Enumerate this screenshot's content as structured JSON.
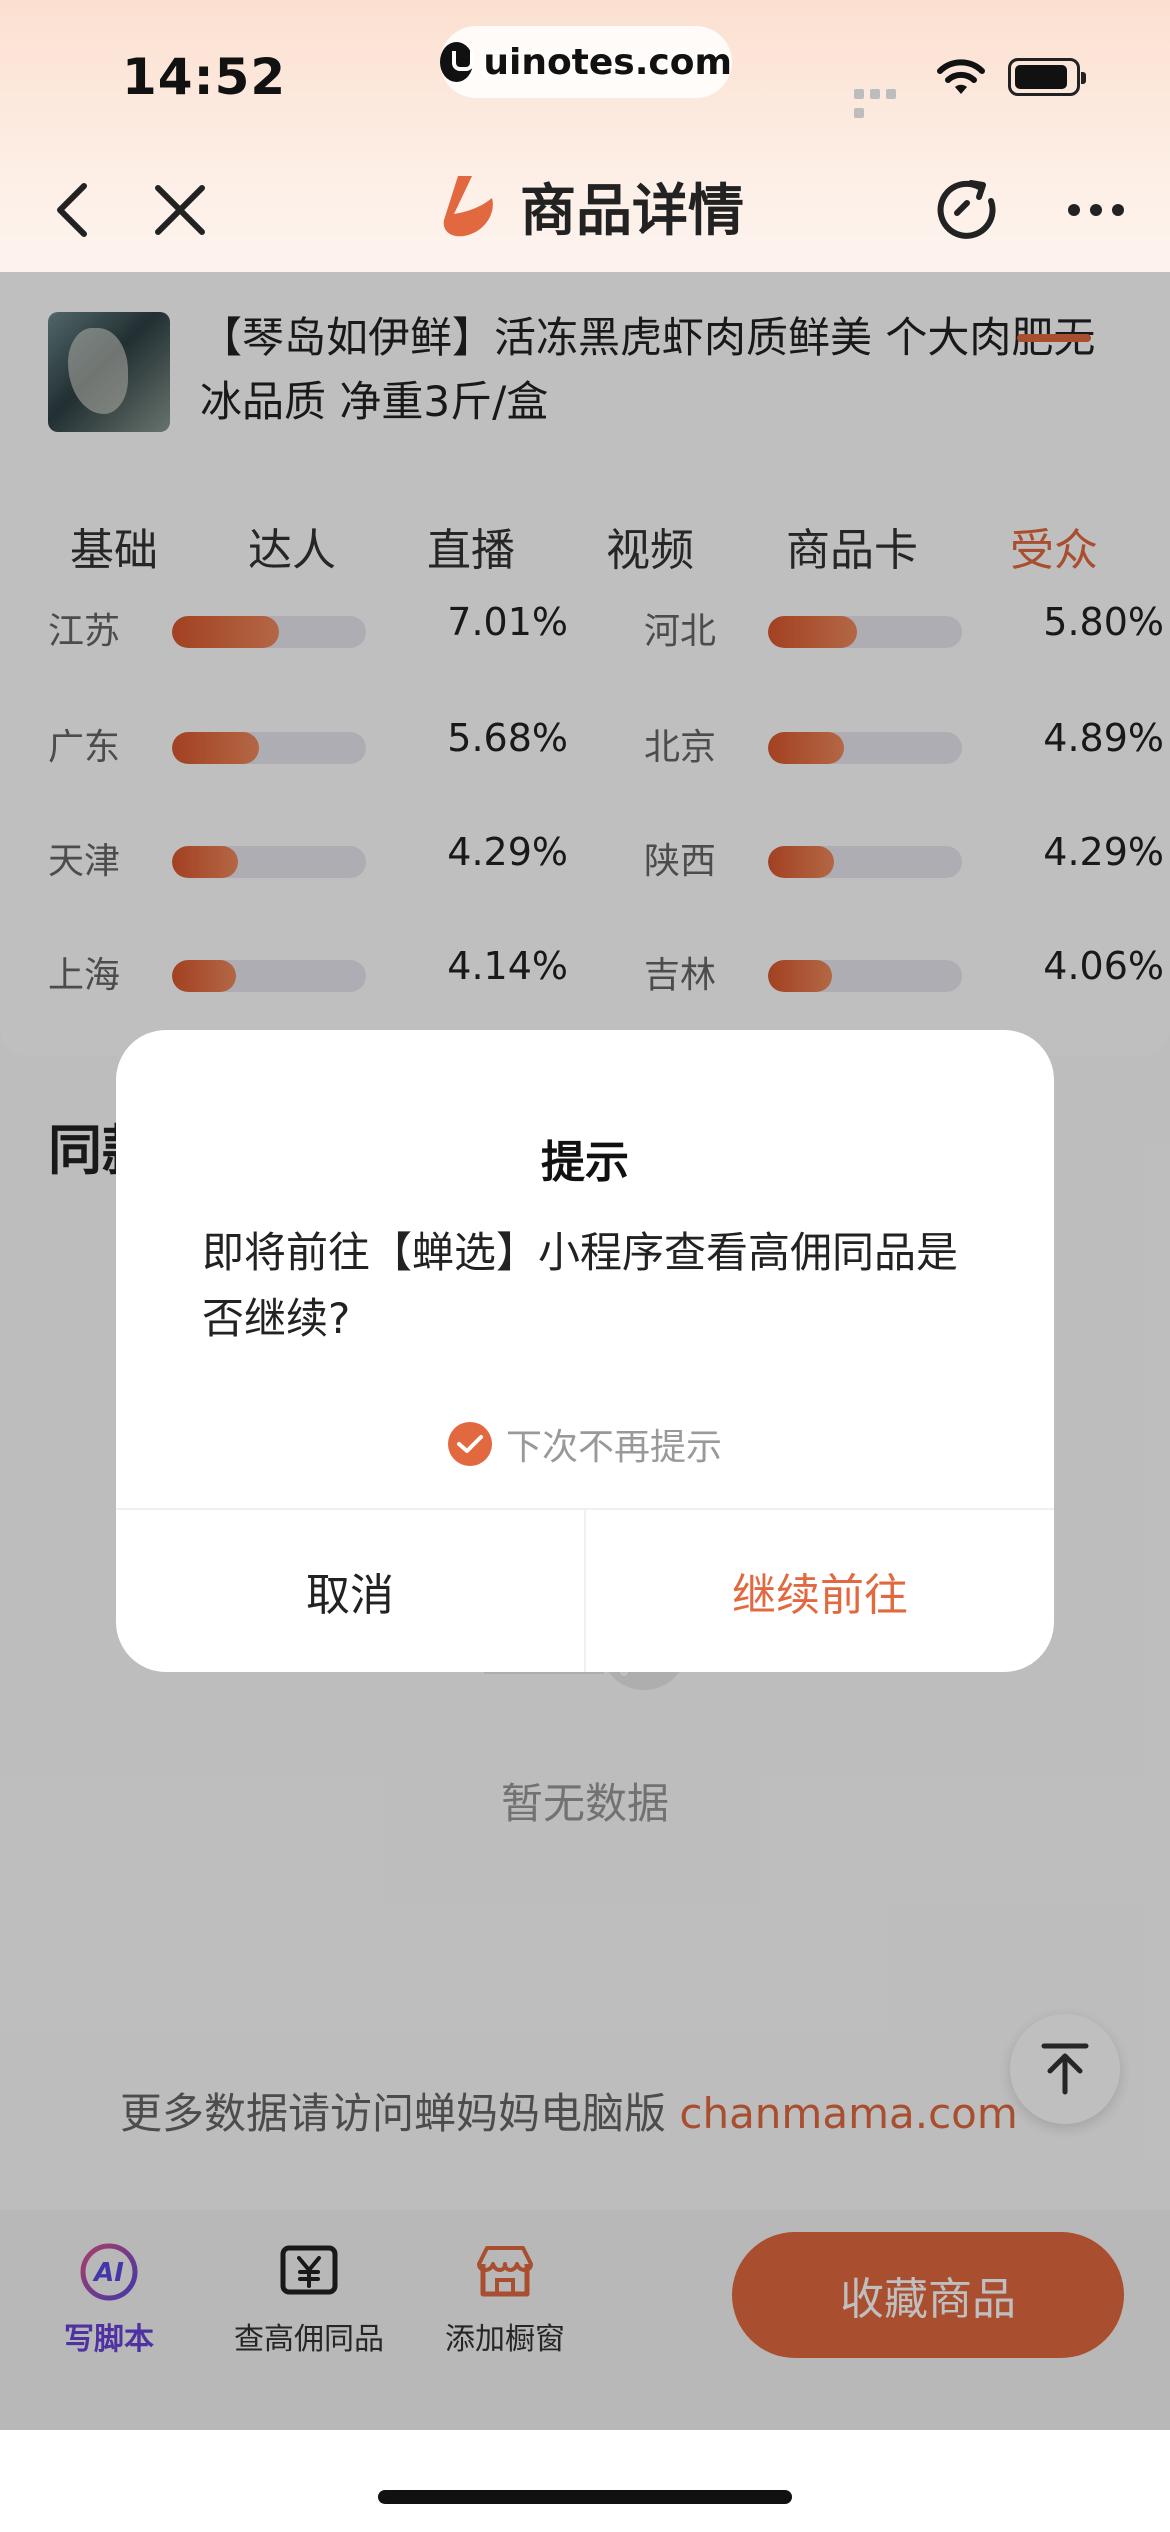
{
  "status_bar": {
    "time": "14:52",
    "url": "uinotes.com"
  },
  "nav": {
    "title": "商品详情"
  },
  "product": {
    "title": "【琴岛如伊鲜】活冻黑虎虾肉质鲜美 个大肉肥无冰品质 净重3斤/盒"
  },
  "tabs": [
    {
      "label": "基础"
    },
    {
      "label": "达人"
    },
    {
      "label": "直播"
    },
    {
      "label": "视频"
    },
    {
      "label": "商品卡"
    },
    {
      "label": "受众"
    }
  ],
  "regions": [
    {
      "name": "江苏",
      "percent": "7.01%",
      "fill": 0.55
    },
    {
      "name": "河北",
      "percent": "5.80%",
      "fill": 0.46
    },
    {
      "name": "广东",
      "percent": "5.68%",
      "fill": 0.45
    },
    {
      "name": "北京",
      "percent": "4.89%",
      "fill": 0.39
    },
    {
      "name": "天津",
      "percent": "4.29%",
      "fill": 0.34
    },
    {
      "name": "陕西",
      "percent": "4.29%",
      "fill": 0.34
    },
    {
      "name": "上海",
      "percent": "4.14%",
      "fill": 0.33
    },
    {
      "name": "吉林",
      "percent": "4.06%",
      "fill": 0.33
    }
  ],
  "section": {
    "title": "同款"
  },
  "empty": {
    "text": "暂无数据"
  },
  "more": {
    "prefix": "更多数据请访问蝉妈妈电脑版 ",
    "link": "chanmama.com"
  },
  "bottom_bar": {
    "script_label": "写脚本",
    "find_label": "查高佣同品",
    "window_label": "添加橱窗",
    "favorite_label": "收藏商品"
  },
  "dialog": {
    "title": "提示",
    "message": "即将前往【蝉选】小程序查看高佣同品是否继续?",
    "checkbox_label": "下次不再提示",
    "cancel_label": "取消",
    "confirm_label": "继续前往"
  },
  "colors": {
    "accent": "#e2683f",
    "ai": "#6a43d8"
  }
}
